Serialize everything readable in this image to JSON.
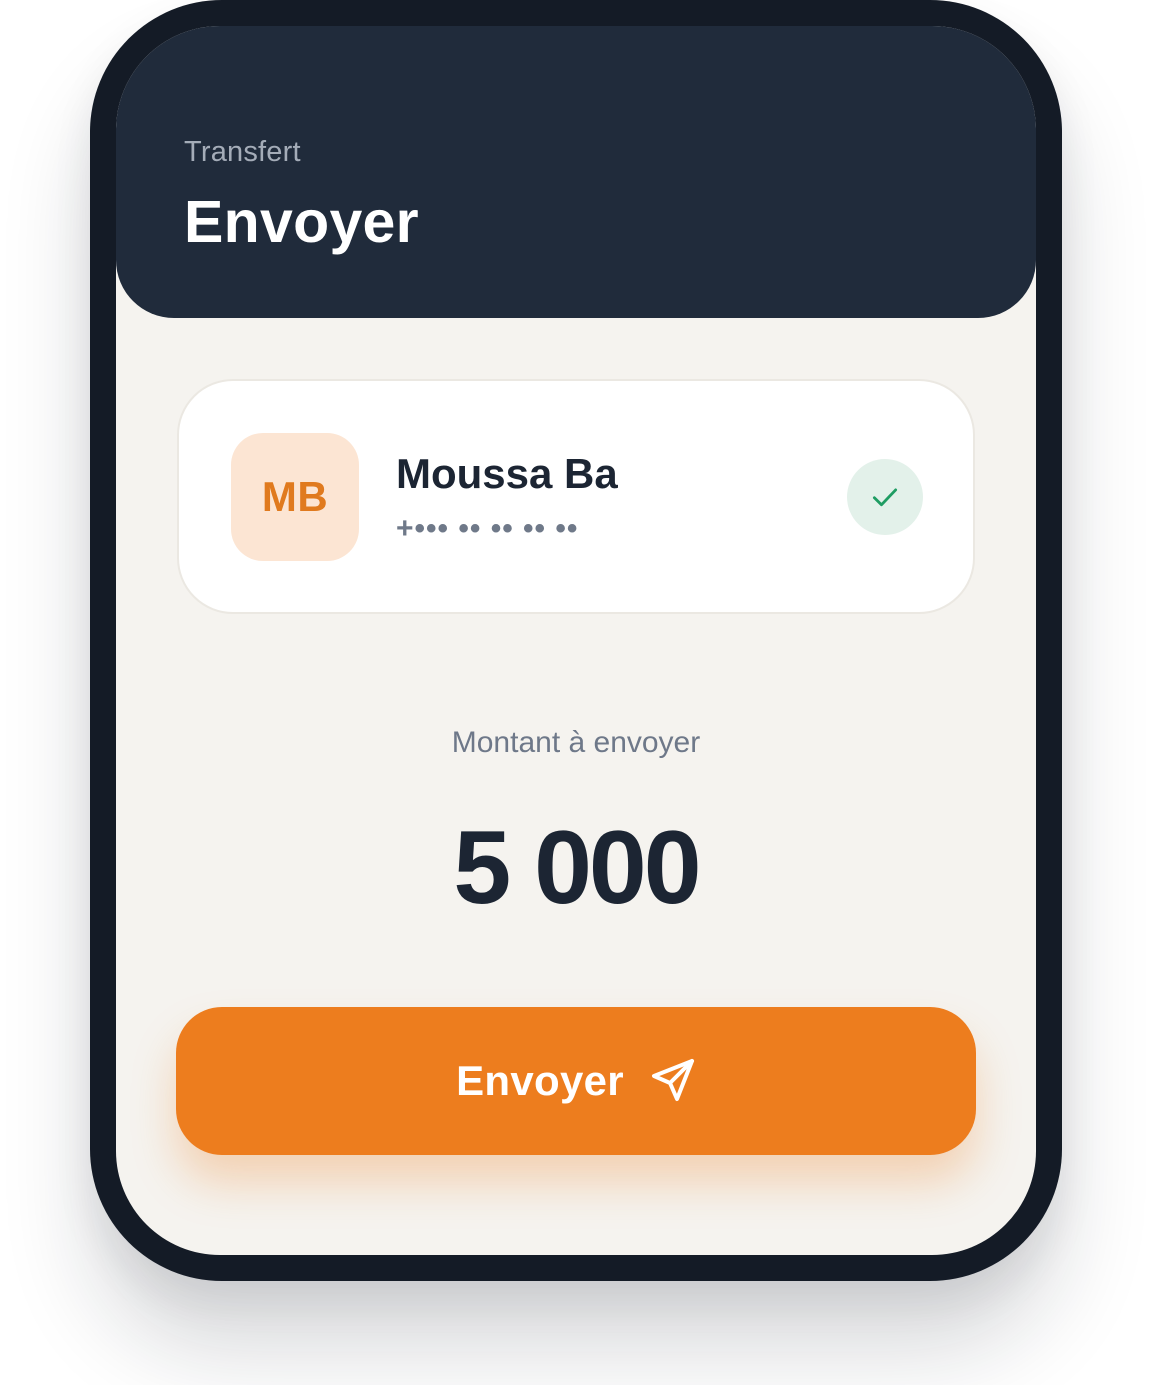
{
  "header": {
    "kicker": "Transfert",
    "title": "Envoyer"
  },
  "recipient": {
    "initials": "MB",
    "name": "Moussa Ba",
    "phone_masked": "+••• •• •• •• ••",
    "status_icon": "check-icon"
  },
  "amount": {
    "label": "Montant à envoyer",
    "value": "5 000"
  },
  "send_button": {
    "label": "Envoyer",
    "icon": "send-icon"
  },
  "colors": {
    "header_bg": "#202b3b",
    "accent": "#ed7d1e",
    "avatar_bg": "#fce5d3",
    "avatar_text": "#e07a1e",
    "success": "#1f9d63",
    "success_bg": "#e3f1ea",
    "screen_bg": "#f5f3ef"
  }
}
